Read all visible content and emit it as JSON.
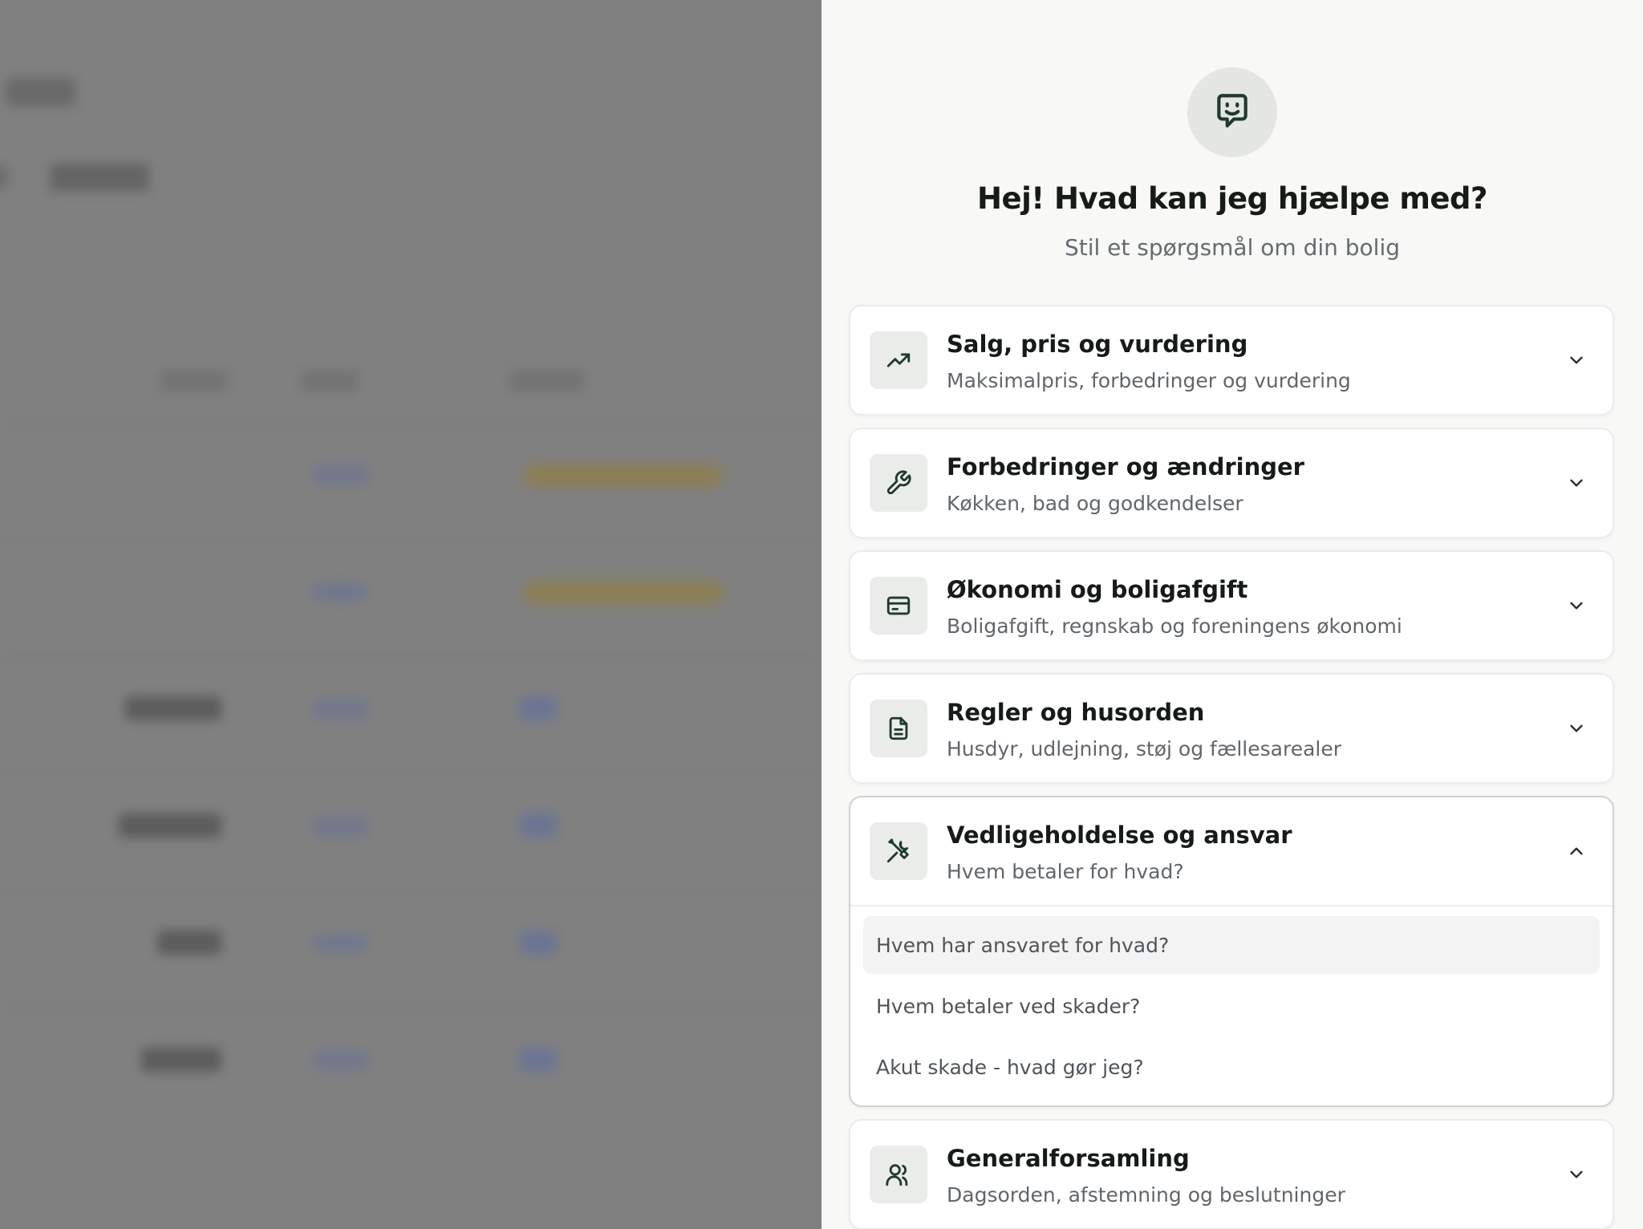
{
  "assistant": {
    "heading": "Hej! Hvad kan jeg hjælpe med?",
    "subheading": "Stil et spørgsmål om din bolig",
    "avatar_icon": "chat-smile-icon"
  },
  "categories": [
    {
      "title": "Salg, pris og vurdering",
      "subtitle": "Maksimalpris, forbedringer og vurdering",
      "icon": "trending-up-icon",
      "expanded": false
    },
    {
      "title": "Forbedringer og ændringer",
      "subtitle": "Køkken, bad og godkendelser",
      "icon": "wrench-icon",
      "expanded": false
    },
    {
      "title": "Økonomi og boligafgift",
      "subtitle": "Boligafgift, regnskab og foreningens økonomi",
      "icon": "wallet-icon",
      "expanded": false
    },
    {
      "title": "Regler og husorden",
      "subtitle": "Husdyr, udlejning, støj og fællesarealer",
      "icon": "document-icon",
      "expanded": false
    },
    {
      "title": "Vedligeholdelse og ansvar",
      "subtitle": "Hvem betaler for hvad?",
      "icon": "tools-icon",
      "expanded": true,
      "questions": [
        "Hvem har ansvaret for hvad?",
        "Hvem betaler ved skader?",
        "Akut skade - hvad gør jeg?"
      ]
    },
    {
      "title": "Generalforsamling",
      "subtitle": "Dagsorden, afstemning og beslutninger",
      "icon": "users-icon",
      "expanded": false
    }
  ],
  "colors": {
    "panel_bg": "#f8f8f7",
    "overlay": "#808080",
    "card_bg": "#ffffff",
    "icon_bg": "#eaecea",
    "text_primary": "#161b18",
    "text_secondary": "#60666b"
  }
}
